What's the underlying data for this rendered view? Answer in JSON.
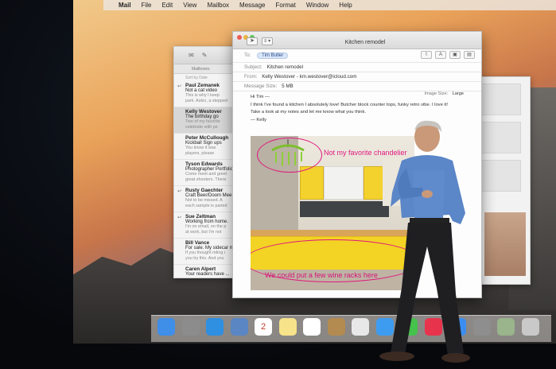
{
  "menubar": {
    "apple_icon": "apple-icon",
    "app_name": "Mail",
    "items": [
      "File",
      "Edit",
      "View",
      "Mailbox",
      "Message",
      "Format",
      "Window",
      "Help"
    ]
  },
  "mail_list": {
    "mailbox_label": "Mailboxes",
    "sort_label": "Sort by Date",
    "messages": [
      {
        "from": "Paul Zemanek",
        "subject": "Not a cat video",
        "preview1": "This is why I keep",
        "preview2": "park. Askio, a stepped",
        "replied": true,
        "selected": false
      },
      {
        "from": "Kelly Westover",
        "subject": "The birthday go",
        "preview1": "Two of my favorite",
        "preview2": "celebrate with pe",
        "replied": false,
        "selected": true
      },
      {
        "from": "Peter McCullough",
        "subject": "Kickball Sign ups",
        "preview1": "You know it was",
        "preview2": "players, please",
        "replied": false,
        "selected": false
      },
      {
        "from": "Tyson Edwards",
        "subject": "Photographer Portfolio",
        "preview1": "Come meet and greet",
        "preview2": "great shooters. There",
        "replied": false,
        "selected": false
      },
      {
        "from": "Rusty Gaechter",
        "subject": "Craft Beer/Doom Mee",
        "preview1": "Not to be missed. A",
        "preview2": "each sample is paired",
        "replied": true,
        "selected": false
      },
      {
        "from": "Sue Zeltman",
        "subject": "Working from home.",
        "preview1": "I'm on email, on the p",
        "preview2": "at work, but I'm not",
        "replied": true,
        "selected": false
      },
      {
        "from": "Bill Vance",
        "subject": "For sale. My sidecar m",
        "preview1": "If you thought riding i",
        "preview2": "you try this. And you",
        "replied": false,
        "selected": false
      },
      {
        "from": "Caren Alpert",
        "subject": "Your readers have ...",
        "preview1": "",
        "preview2": "",
        "replied": false,
        "selected": false
      }
    ]
  },
  "compose": {
    "title": "Kitchen remodel",
    "header_menu_label": "≡ ▾",
    "to_label": "To:",
    "to_recipient": "Tim Butler",
    "subject_label": "Subject:",
    "subject_value": "Kitchen remodel",
    "from_label": "From:",
    "from_value": "Kelly Westover - km.westover@icloud.com",
    "size_label": "Message Size:",
    "size_value": "5 MB",
    "image_size_label": "Image Size:",
    "image_size_value": "Large",
    "font_button": "A",
    "body_lines": [
      "Hi Tim —",
      "I think I've found a kitchen I absolutely love! Butcher block counter tops, funky retro vibe. I love it!",
      "Take a look at my notes and let me know what you think.",
      "— Kelly"
    ],
    "annotations": {
      "chandelier_note": "Not my favorite chandelier",
      "wine_rack_note": "We could put a few wine racks here"
    }
  },
  "dock": {
    "icons": [
      {
        "name": "finder-icon",
        "color": "#3f8ee8"
      },
      {
        "name": "launchpad-icon",
        "color": "#8c8c8c"
      },
      {
        "name": "safari-icon",
        "color": "#2f8fe0"
      },
      {
        "name": "mail-stamp-icon",
        "color": "#5a86c4"
      },
      {
        "name": "calendar-icon",
        "color": "#ffffff",
        "label": "2"
      },
      {
        "name": "notes-icon",
        "color": "#f6e38a"
      },
      {
        "name": "reminders-icon",
        "color": "#ffffff"
      },
      {
        "name": "contacts-icon",
        "color": "#b38a4f"
      },
      {
        "name": "photos-icon",
        "color": "#e8e8e8"
      },
      {
        "name": "messages-icon",
        "color": "#3e9cf0"
      },
      {
        "name": "facetime-icon",
        "color": "#45c24b"
      },
      {
        "name": "itunes-icon",
        "color": "#e8334d"
      },
      {
        "name": "app-store-icon",
        "color": "#3b8ef0"
      },
      {
        "name": "system-preferences-icon",
        "color": "#8e8e8e"
      },
      {
        "name": "preview-icon",
        "color": "#9ab48c"
      },
      {
        "name": "trash-icon",
        "color": "#c9c9c9"
      }
    ]
  },
  "colors": {
    "annotation": "#e0187e",
    "cabinet_yellow": "#f4d22e"
  }
}
